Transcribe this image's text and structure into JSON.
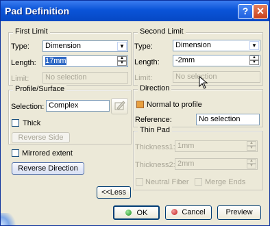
{
  "window": {
    "title": "Pad Definition",
    "help_label": "?",
    "close_label": "✕"
  },
  "first_limit": {
    "legend": "First Limit",
    "type_label": "Type:",
    "type_value": "Dimension",
    "length_label": "Length:",
    "length_value": "17mm",
    "limit_label": "Limit:",
    "limit_value": "No selection"
  },
  "second_limit": {
    "legend": "Second Limit",
    "type_label": "Type:",
    "type_value": "Dimension",
    "length_label": "Length:",
    "length_value": "-2mm",
    "limit_label": "Limit:",
    "limit_value": "No selection"
  },
  "profile": {
    "legend": "Profile/Surface",
    "selection_label": "Selection:",
    "selection_value": "Complex",
    "thick_label": "Thick",
    "reverse_side_label": "Reverse Side"
  },
  "mirrored_label": "Mirrored extent",
  "reverse_direction_label": "Reverse Direction",
  "direction": {
    "legend": "Direction",
    "normal_label": "Normal to profile",
    "reference_label": "Reference:",
    "reference_value": "No selection"
  },
  "thin_pad": {
    "legend": "Thin Pad",
    "thickness1_label": "Thickness1:",
    "thickness1_value": "1mm",
    "thickness2_label": "Thickness2:",
    "thickness2_value": "2mm",
    "neutral_label": "Neutral Fiber",
    "merge_label": "Merge Ends"
  },
  "less_label": "<<Less",
  "ok_label": "OK",
  "cancel_label": "Cancel",
  "preview_label": "Preview"
}
